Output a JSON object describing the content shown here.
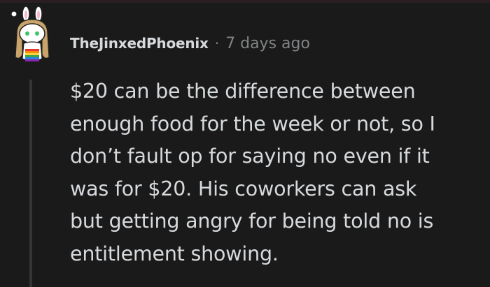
{
  "comment": {
    "username": "TheJinxedPhoenix",
    "separator": "·",
    "timestamp": "7 days ago",
    "avatar_icon": "snoo-avatar-icon",
    "body_lines": [
      "$20 can be the difference between",
      "enough food for the week or not, so I",
      "don’t fault op for saying no even if it",
      "was for $20. His coworkers can ask",
      "but getting angry for being told no is",
      "entitlement showing."
    ]
  },
  "colors": {
    "background": "#1a1a1b",
    "text": "#d7dadc",
    "meta": "#818384",
    "thread_line": "#343536"
  }
}
